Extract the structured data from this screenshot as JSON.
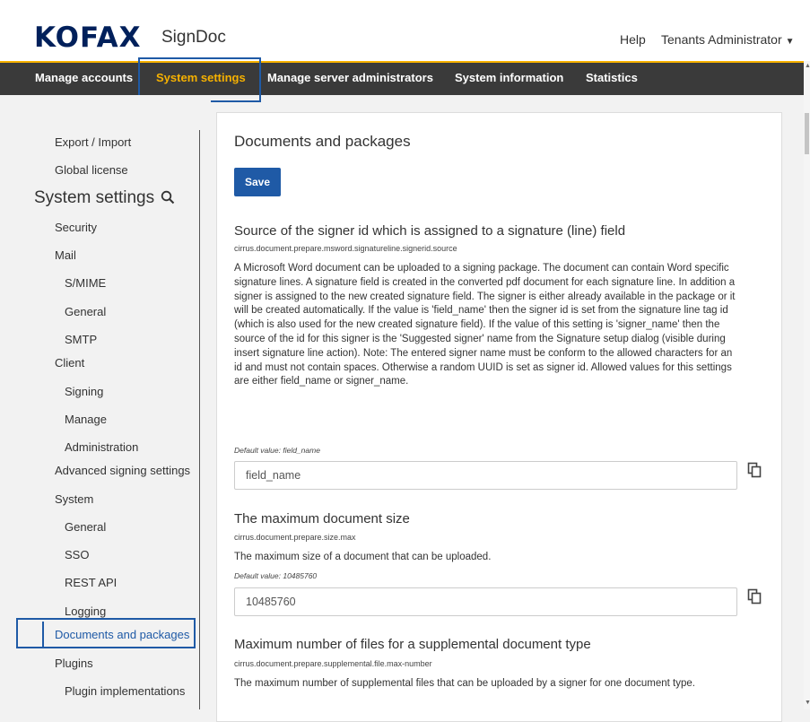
{
  "header": {
    "logo": "KOFAX",
    "product": "SignDoc",
    "help": "Help",
    "tenant": "Tenants Administrator"
  },
  "nav": {
    "items": [
      {
        "label": "Manage accounts"
      },
      {
        "label": "System settings"
      },
      {
        "label": "Manage server administrators"
      },
      {
        "label": "System information"
      },
      {
        "label": "Statistics"
      }
    ]
  },
  "sidebar": {
    "export_import": "Export / Import",
    "global_license": "Global license",
    "heading": "System settings",
    "items": [
      "Security",
      "Mail",
      "S/MIME",
      "General",
      "SMTP",
      "Client",
      "Signing",
      "Manage",
      "Administration",
      "Advanced signing settings",
      "System",
      "General",
      "SSO",
      "REST API",
      "Logging",
      "Documents and packages",
      "Plugins",
      "Plugin implementations"
    ]
  },
  "main": {
    "title": "Documents and packages",
    "save": "Save",
    "sections": [
      {
        "title": "Source of the signer id which is assigned to a signature (line) field",
        "key": "cirrus.document.prepare.msword.signatureline.signerid.source",
        "description": "A Microsoft Word document can be uploaded to a signing package. The document can contain Word specific signature lines. A signature field is created in the converted pdf document for each signature line. In addition a signer is assigned to the new created signature field. The signer is either already available in the package or it will be created automatically. If the value is 'field_name' then the signer id is set from the signature line tag id (which is also used for the new created signature field). If the value of this setting is 'signer_name' then the source of the id for this signer is the 'Suggested signer' name from the Signature setup dialog (visible during insert signature line action). Note: The entered signer name must be conform to the allowed characters for an id and must not contain spaces. Otherwise a random UUID is set as signer id. Allowed values for this settings are either field_name or signer_name.",
        "default": "Default value: field_name",
        "value": "field_name"
      },
      {
        "title": "The maximum document size",
        "key": "cirrus.document.prepare.size.max",
        "description": "The maximum size of a document that can be uploaded.",
        "default": "Default value: 10485760",
        "value": "10485760"
      },
      {
        "title": "Maximum number of files for a supplemental document type",
        "key": "cirrus.document.prepare.supplemental.file.max-number",
        "description": "The maximum number of supplemental files that can be uploaded by a signer for one document type."
      }
    ]
  },
  "colors": {
    "brand_navy": "#00205b",
    "nav_bg": "#3a3a3a",
    "accent_yellow": "#f6b100",
    "primary_blue": "#1f5aa6"
  },
  "icons": {
    "search": "search-icon",
    "copy": "copy-icon",
    "caret": "caret-down-icon"
  }
}
